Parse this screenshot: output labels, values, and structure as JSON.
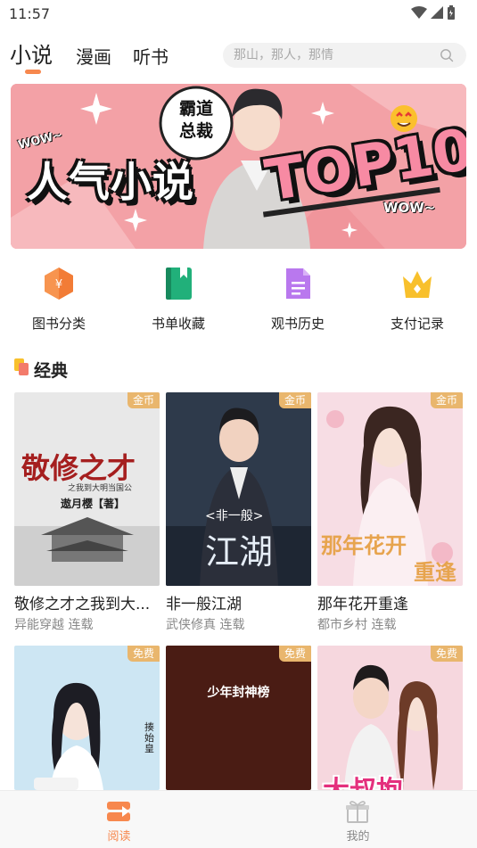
{
  "status_bar": {
    "time": "11:57"
  },
  "nav": {
    "tabs": [
      {
        "label": "小说",
        "active": true
      },
      {
        "label": "漫画",
        "active": false
      },
      {
        "label": "听书",
        "active": false
      }
    ],
    "search": {
      "placeholder": "那山，那人，那情"
    }
  },
  "banner": {
    "badge": "霸道\n总裁",
    "headline": "人气小说",
    "highlight": "TOP10",
    "wow_left": "WOW~",
    "wow_right": "WOW~"
  },
  "quick_links": [
    {
      "label": "图书分类",
      "icon": "category-icon"
    },
    {
      "label": "书单收藏",
      "icon": "bookmark-book-icon"
    },
    {
      "label": "观书历史",
      "icon": "history-doc-icon"
    },
    {
      "label": "支付记录",
      "icon": "crown-icon"
    }
  ],
  "section": {
    "title": "经典"
  },
  "books": [
    {
      "title": "敬修之才之我到大...",
      "genre": "异能穿越",
      "status": "连载",
      "badge": "金币",
      "cover_text": "敬修之才",
      "cover_sub": "之我到大明当国公",
      "cover_author": "遨月樱【著】"
    },
    {
      "title": "非一般江湖",
      "genre": "武侠修真",
      "status": "连载",
      "badge": "金币",
      "cover_text": "江湖",
      "cover_sub": "<非一般>"
    },
    {
      "title": "那年花开重逢",
      "genre": "都市乡村",
      "status": "连载",
      "badge": "金币",
      "cover_text": "那年花开",
      "cover_sub": "重逢"
    },
    {
      "title": "",
      "genre": "",
      "status": "",
      "badge": "免费",
      "cover_text": "",
      "cover_sub": "揍始皇"
    },
    {
      "title": "",
      "genre": "",
      "status": "",
      "badge": "免费",
      "cover_text": "少年封神榜",
      "cover_sub": ""
    },
    {
      "title": "",
      "genre": "",
      "status": "",
      "badge": "免费",
      "cover_text": "大叔抱",
      "cover_sub": ""
    }
  ],
  "bottom_nav": [
    {
      "label": "阅读",
      "active": true,
      "icon": "read-icon"
    },
    {
      "label": "我的",
      "active": false,
      "icon": "gift-icon"
    }
  ],
  "colors": {
    "accent": "#f7884e",
    "badge": "#e9b66d",
    "inactive": "#888888"
  }
}
